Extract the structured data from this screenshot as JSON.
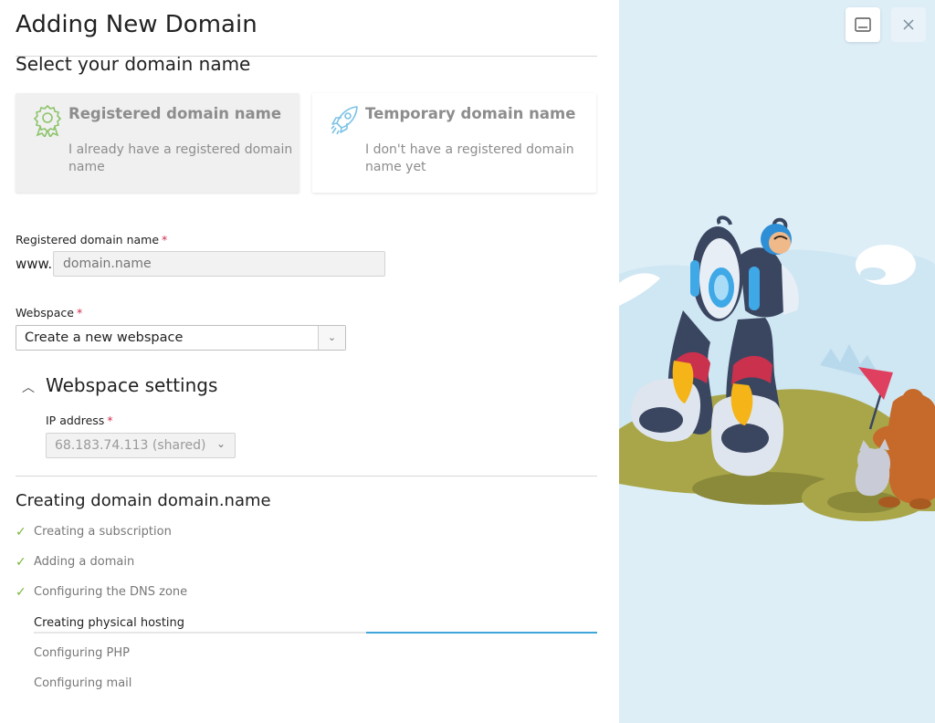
{
  "dialog": {
    "title": "Adding New Domain",
    "section_title": "Select your domain name"
  },
  "domain_options": [
    {
      "title": "Registered domain name",
      "description": "I already have a registered domain name",
      "icon": "certificate-badge-icon",
      "selected": true
    },
    {
      "title": "Temporary domain name",
      "description": "I don't have a registered domain name yet",
      "icon": "rocket-icon",
      "selected": false
    }
  ],
  "registered_domain": {
    "label": "Registered domain name",
    "required_mark": "*",
    "prefix": "www.",
    "placeholder": "domain.name"
  },
  "webspace": {
    "label": "Webspace",
    "required_mark": "*",
    "selected": "Create a new webspace",
    "dropdown_icon": "chevron-down-icon"
  },
  "webspace_settings": {
    "title": "Webspace settings",
    "expanded": true,
    "ip_label": "IP address",
    "required_mark": "*",
    "ip_value": "68.183.74.113 (shared)"
  },
  "progress": {
    "title": "Creating domain domain.name",
    "steps": [
      {
        "label": "Creating a subscription",
        "status": "done"
      },
      {
        "label": "Adding a domain",
        "status": "done"
      },
      {
        "label": "Configuring the DNS zone",
        "status": "done"
      },
      {
        "label": "Creating physical hosting",
        "status": "in-progress"
      },
      {
        "label": "Configuring PHP",
        "status": "pending"
      },
      {
        "label": "Configuring mail",
        "status": "pending"
      }
    ],
    "current_step_progress": 0.41,
    "check_icon": "✓"
  },
  "window_controls": {
    "minimize_icon": "minimize-icon",
    "close_icon": "close-icon"
  },
  "colors": {
    "accent": "#3ea6d9",
    "success": "#7ab73b",
    "required": "#d02d4a",
    "illustration_bg": "#ddeef7"
  }
}
